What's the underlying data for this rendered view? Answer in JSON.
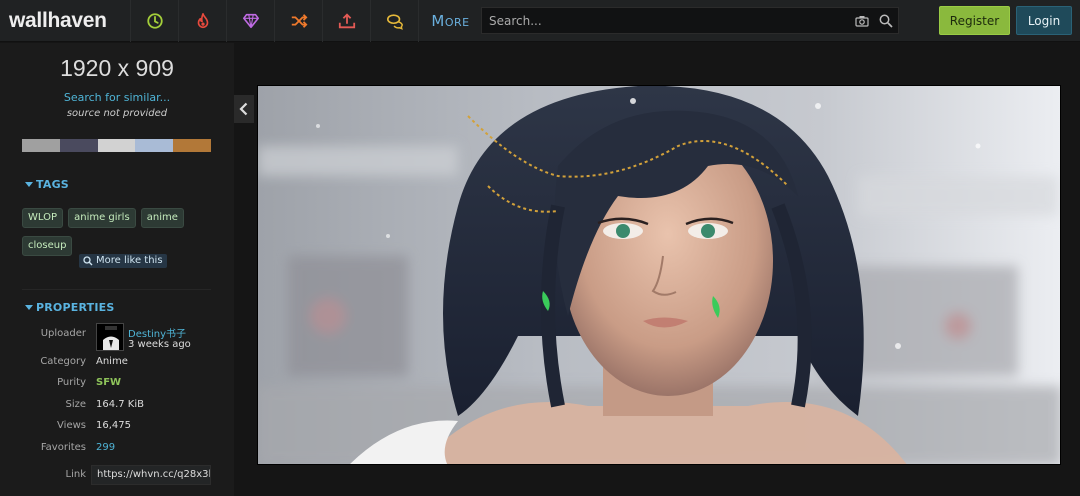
{
  "header": {
    "logo": "wallhaven",
    "nav": [
      {
        "icon": "clock-icon",
        "color": "#a4cf3a"
      },
      {
        "icon": "fire-icon",
        "color": "#e84a3d"
      },
      {
        "icon": "gem-icon",
        "color": "#c06be4"
      },
      {
        "icon": "shuffle-icon",
        "color": "#f07a2c"
      },
      {
        "icon": "upload-icon",
        "color": "#e35a55"
      },
      {
        "icon": "chat-icon",
        "color": "#e6b93a"
      }
    ],
    "more_label": "More",
    "search_placeholder": "Search...",
    "register_label": "Register",
    "login_label": "Login"
  },
  "sidebar": {
    "resolution": "1920 x 909",
    "search_similar": "Search for similar...",
    "source": "source not provided",
    "palette": [
      "#a0a0a0",
      "#4a4a5e",
      "#d2d2d2",
      "#a9bbd6",
      "#b27838"
    ],
    "tags_title": "TAGS",
    "tags": [
      "WLOP",
      "anime girls",
      "anime",
      "closeup"
    ],
    "more_like_this": "More like this",
    "properties_title": "PROPERTIES",
    "properties": {
      "uploader_label": "Uploader",
      "uploader_name": "Destiny书子",
      "uploader_time": "3 weeks ago",
      "category_label": "Category",
      "category": "Anime",
      "purity_label": "Purity",
      "purity": "SFW",
      "size_label": "Size",
      "size": "164.7 KiB",
      "views_label": "Views",
      "views": "16,475",
      "favorites_label": "Favorites",
      "favorites": "299",
      "link_label": "Link",
      "link": "https://whvn.cc/q28x3l"
    }
  },
  "colors": {
    "purity_sfw": "#8ec35a",
    "favorites": "#4fb4d6",
    "uploader": "#4fb4d6"
  }
}
